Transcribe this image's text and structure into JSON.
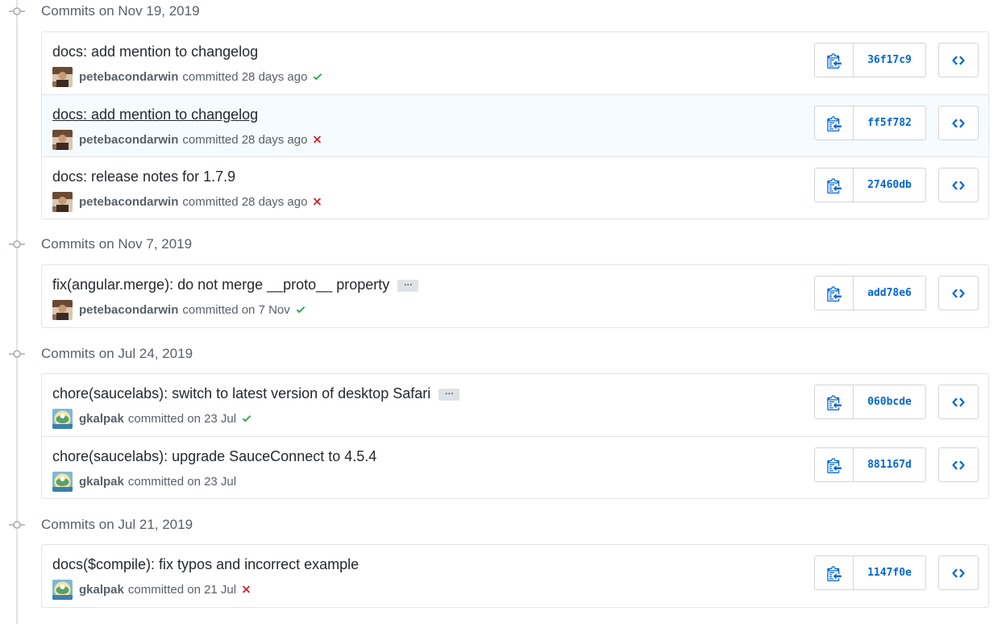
{
  "groups": [
    {
      "title": "Commits on Nov 19, 2019",
      "commits": [
        {
          "message": "docs: add mention to changelog",
          "author": "petebacondarwin",
          "committed": "committed 28 days ago",
          "status": "success",
          "sha": "36f17c9"
        },
        {
          "message": "docs: add mention to changelog",
          "author": "petebacondarwin",
          "committed": "committed 28 days ago",
          "status": "failure",
          "sha": "ff5f782"
        },
        {
          "message": "docs: release notes for 1.7.9",
          "author": "petebacondarwin",
          "committed": "committed 28 days ago",
          "status": "failure",
          "sha": "27460db"
        }
      ]
    },
    {
      "title": "Commits on Nov 7, 2019",
      "commits": [
        {
          "message": "fix(angular.merge): do not merge __proto__ property",
          "author": "petebacondarwin",
          "committed": "committed on 7 Nov",
          "status": "success",
          "sha": "add78e6",
          "ellipsis": "…"
        }
      ]
    },
    {
      "title": "Commits on Jul 24, 2019",
      "commits": [
        {
          "message": "chore(saucelabs): switch to latest version of desktop Safari",
          "author": "gkalpak",
          "committed": "committed on 23 Jul",
          "status": "success",
          "sha": "060bcde",
          "ellipsis": "…"
        },
        {
          "message": "chore(saucelabs): upgrade SauceConnect to 4.5.4",
          "author": "gkalpak",
          "committed": "committed on 23 Jul",
          "status": "none",
          "sha": "881167d"
        }
      ]
    },
    {
      "title": "Commits on Jul 21, 2019",
      "commits": [
        {
          "message": "docs($compile): fix typos and incorrect example",
          "author": "gkalpak",
          "committed": "committed on 21 Jul",
          "status": "failure",
          "sha": "1147f0e"
        }
      ]
    }
  ],
  "icons": {
    "copy": "clippy-icon",
    "browse": "code-icon",
    "success": "check-icon",
    "failure": "x-icon",
    "node": "git-commit-icon"
  },
  "colors": {
    "success": "#28a745",
    "failure": "#cb2431",
    "link": "#0366d6",
    "muted": "#586069"
  }
}
